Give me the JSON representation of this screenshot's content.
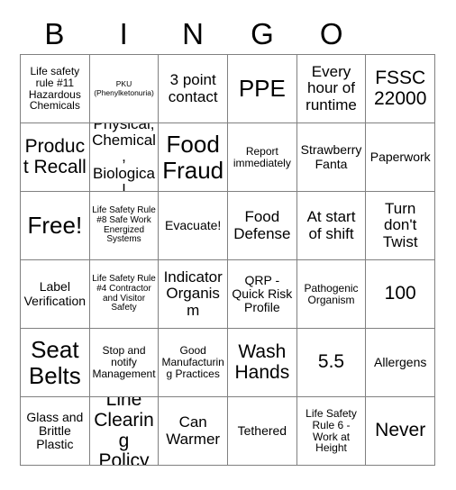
{
  "card": {
    "title": "BINGO",
    "header_letters": [
      "B",
      "I",
      "N",
      "G",
      "O",
      ""
    ],
    "columns": 6,
    "rows": 6,
    "border_color": "#808080",
    "text_color": "#000000",
    "background_color": "#ffffff",
    "cells": [
      [
        {
          "text": "Life safety rule #11 Hazardous Chemicals",
          "size": "s"
        },
        {
          "text": "PKU (Phenylketonuria)",
          "size": "xxs"
        },
        {
          "text": "3 point contact",
          "size": "l"
        },
        {
          "text": "PPE",
          "size": "xxl"
        },
        {
          "text": "Every hour of runtime",
          "size": "l"
        },
        {
          "text": "FSSC 22000",
          "size": "xl"
        }
      ],
      [
        {
          "text": "Product Recall",
          "size": "xl"
        },
        {
          "text": "Physical, Chemical, Biological",
          "size": "l"
        },
        {
          "text": "Food Fraud",
          "size": "xxl"
        },
        {
          "text": "Report immediately",
          "size": "s"
        },
        {
          "text": "Strawberry Fanta",
          "size": "m"
        },
        {
          "text": "Paperwork",
          "size": "m"
        }
      ],
      [
        {
          "text": "Free!",
          "size": "xxl"
        },
        {
          "text": "Life Safety Rule #8 Safe Work Energized Systems",
          "size": "xs"
        },
        {
          "text": "Evacuate!",
          "size": "m"
        },
        {
          "text": "Food Defense",
          "size": "l"
        },
        {
          "text": "At start of shift",
          "size": "l"
        },
        {
          "text": "Turn don't Twist",
          "size": "l"
        }
      ],
      [
        {
          "text": "Label Verification",
          "size": "m"
        },
        {
          "text": "Life Safety Rule #4 Contractor and Visitor Safety",
          "size": "xs"
        },
        {
          "text": "Indicator Organism",
          "size": "l"
        },
        {
          "text": "QRP - Quick Risk Profile",
          "size": "m"
        },
        {
          "text": "Pathogenic Organism",
          "size": "s"
        },
        {
          "text": "100",
          "size": "xl"
        }
      ],
      [
        {
          "text": "Seat Belts",
          "size": "xxl"
        },
        {
          "text": "Stop and notify Management",
          "size": "s"
        },
        {
          "text": "Good Manufacturing Practices",
          "size": "s"
        },
        {
          "text": "Wash Hands",
          "size": "xl"
        },
        {
          "text": "5.5",
          "size": "xl"
        },
        {
          "text": "Allergens",
          "size": "m"
        }
      ],
      [
        {
          "text": "Glass and Brittle Plastic",
          "size": "m"
        },
        {
          "text": "Line Clearing Policy",
          "size": "xl"
        },
        {
          "text": "Can Warmer",
          "size": "l"
        },
        {
          "text": "Tethered",
          "size": "m"
        },
        {
          "text": "Life Safety Rule 6 - Work at Height",
          "size": "s"
        },
        {
          "text": "Never",
          "size": "xl"
        }
      ]
    ]
  }
}
